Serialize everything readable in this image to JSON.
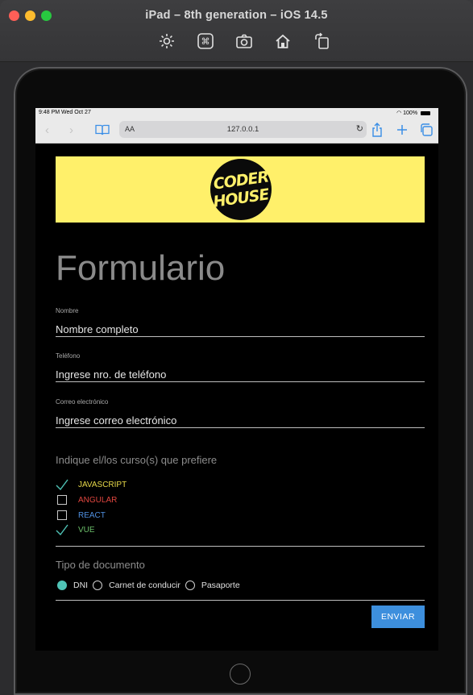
{
  "window": {
    "title": "iPad – 8th generation – iOS 14.5",
    "toolbar_icons": [
      "brightness-icon",
      "command-icon",
      "screenshot-icon",
      "home-icon",
      "rotate-icon"
    ]
  },
  "statusbar": {
    "time": "9:48 PM  Wed Oct 27",
    "battery": "100%"
  },
  "safari": {
    "aa_label": "AA",
    "url": "127.0.0.1",
    "reload_glyph": "↻"
  },
  "banner": {
    "logo_line1": "CODER",
    "logo_line2": "HOUSE",
    "bg_color": "#fff06a"
  },
  "form": {
    "title": "Formulario",
    "fields": [
      {
        "label": "Nombre",
        "placeholder": "Nombre completo"
      },
      {
        "label": "Teléfono",
        "placeholder": "Ingrese nro. de teléfono"
      },
      {
        "label": "Correo electrónico",
        "placeholder": "Ingrese correo electrónico"
      }
    ],
    "courses_label": "Indique el/los curso(s) que prefiere",
    "courses": [
      {
        "name": "JAVASCRIPT",
        "checked": true,
        "color": "#e8d94a"
      },
      {
        "name": "ANGULAR",
        "checked": false,
        "color": "#e0463f"
      },
      {
        "name": "REACT",
        "checked": false,
        "color": "#4f8fe0"
      },
      {
        "name": "VUE",
        "checked": true,
        "color": "#6cbf6a"
      }
    ],
    "doc_label": "Tipo de documento",
    "doc_options": [
      {
        "name": "DNI",
        "selected": true
      },
      {
        "name": "Carnet de conducir",
        "selected": false
      },
      {
        "name": "Pasaporte",
        "selected": false
      }
    ],
    "submit_label": "ENVIAR"
  },
  "colors": {
    "accent_teal": "#4fc3b6",
    "button_blue": "#3d8fdd"
  }
}
